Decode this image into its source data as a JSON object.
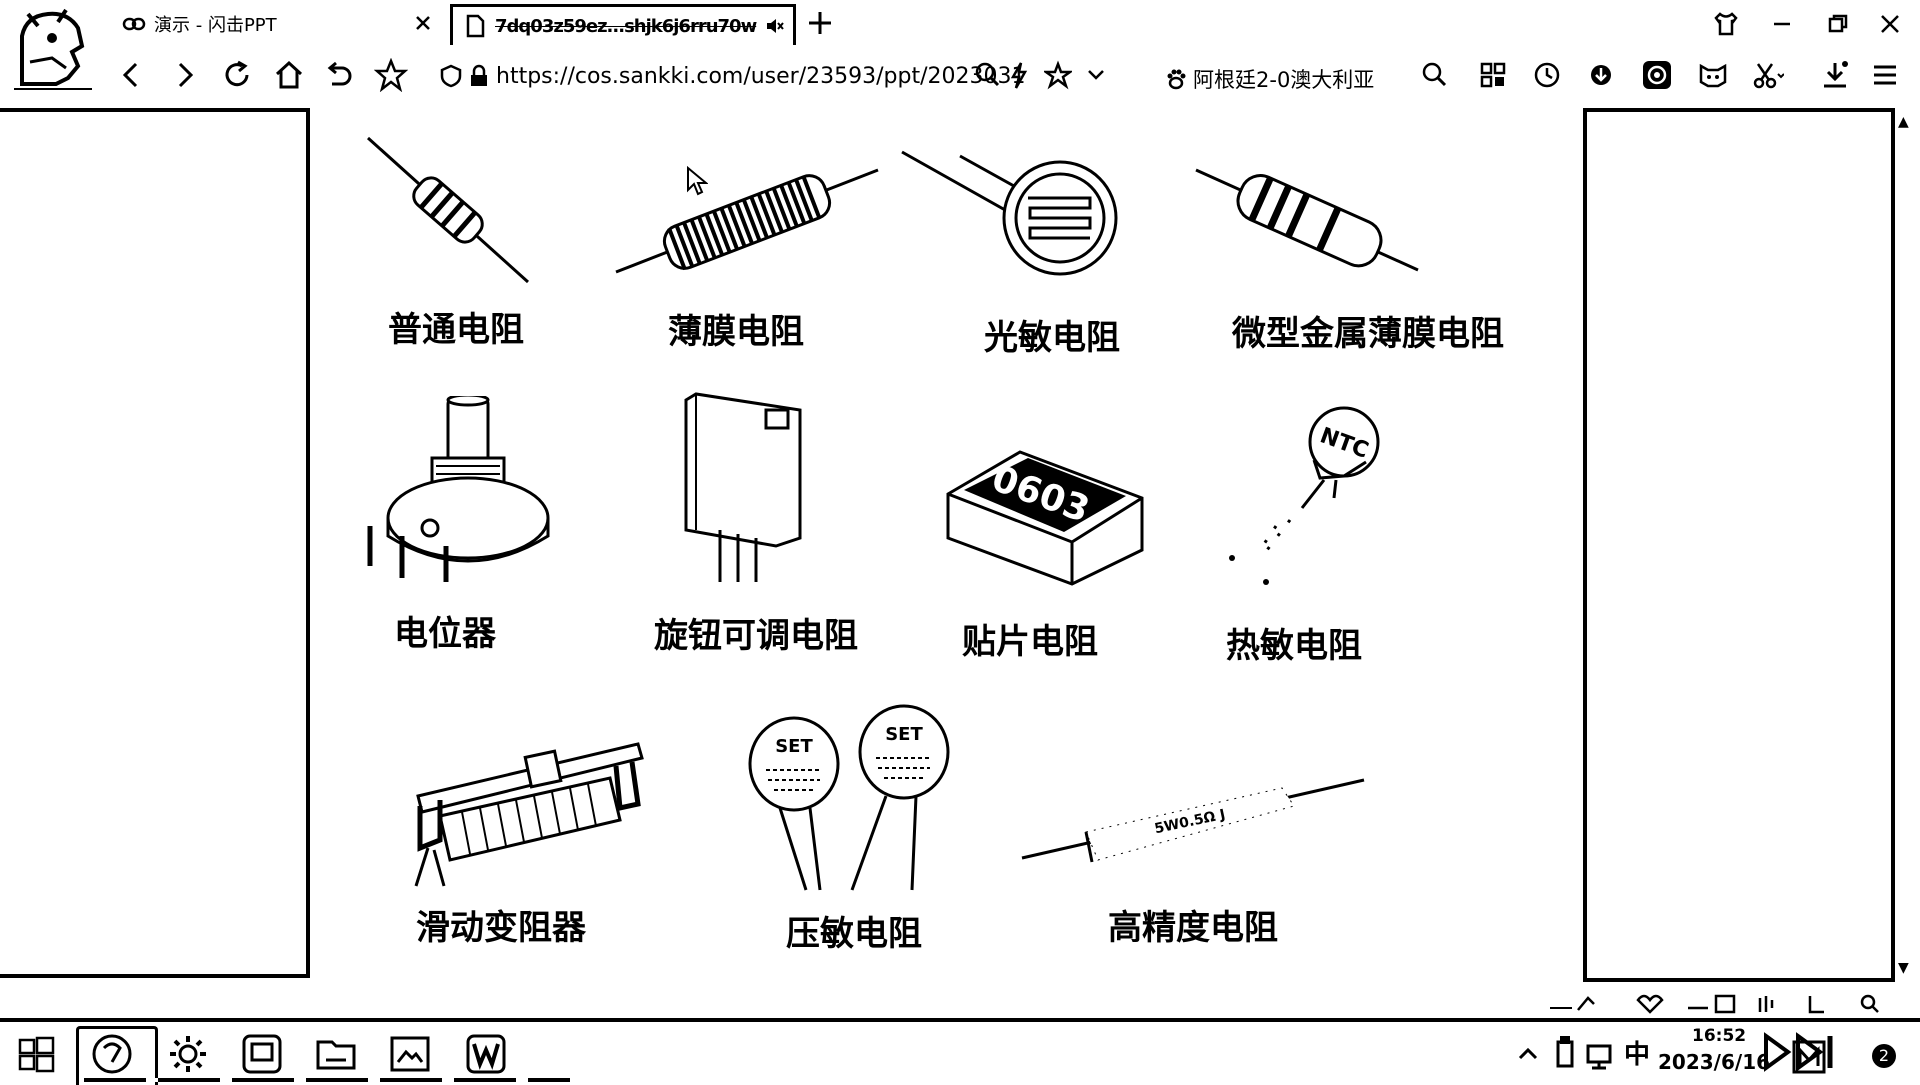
{
  "browser": {
    "tabs": [
      {
        "title": "演示 - 闪击PPT",
        "icon": "link-icon",
        "active": false
      },
      {
        "title": "7dq03z59ez...shjk6j6rru70w",
        "icon": "document-icon",
        "active": true
      }
    ],
    "address": {
      "url": "https://cos.sankki.com/user/23593/ppt/2023031"
    },
    "bookmark": {
      "label": "阿根廷2-0澳大利亚"
    }
  },
  "slide": {
    "components": [
      {
        "label": "普通电阻",
        "icon": "carbon-resistor"
      },
      {
        "label": "薄膜电阻",
        "icon": "film-resistor"
      },
      {
        "label": "光敏电阻",
        "icon": "photoresistor"
      },
      {
        "label": "微型金属薄膜电阻",
        "icon": "metal-film-resistor"
      },
      {
        "label": "电位器",
        "icon": "potentiometer"
      },
      {
        "label": "旋钮可调电阻",
        "icon": "trimmer-resistor"
      },
      {
        "label": "贴片电阻",
        "icon": "smd-resistor",
        "marking": "0603"
      },
      {
        "label": "热敏电阻",
        "icon": "thermistor",
        "marking": "NTC"
      },
      {
        "label": "滑动变阻器",
        "icon": "rheostat"
      },
      {
        "label": "压敏电阻",
        "icon": "varistor",
        "marking": "SET"
      },
      {
        "label": "高精度电阻",
        "icon": "precision-resistor",
        "marking": "5W0.5Ω J"
      }
    ]
  },
  "taskbar": {
    "clock": {
      "time": "16:52",
      "date": "2023/6/16"
    },
    "ime": "中",
    "notifications": "2"
  }
}
